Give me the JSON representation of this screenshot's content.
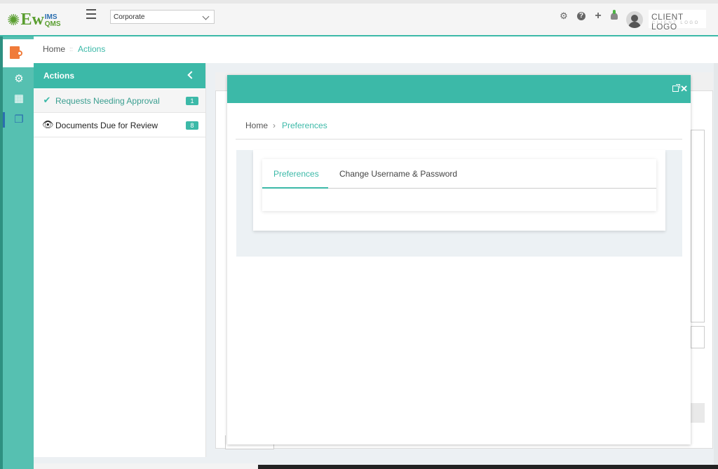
{
  "header": {
    "logo": {
      "main": "Ew",
      "sup": "IMS",
      "sub": "QMS"
    },
    "site_select": "Corporate",
    "icons": [
      "gear-icon",
      "help-icon",
      "plus-icon",
      "bell-icon"
    ],
    "client_logo": {
      "big": "CLIENT LOGO",
      "small": "CLIENT LOGO"
    }
  },
  "breadcrumb": {
    "home": "Home",
    "sep": "::",
    "current": "Actions"
  },
  "sidebar": {
    "title": "Actions",
    "items": [
      {
        "label": "Requests Needing Approval",
        "count": "1",
        "icon": "check-icon",
        "active": true
      },
      {
        "label": "Documents Due for Review",
        "count": "8",
        "icon": "eye-icon",
        "active": false
      }
    ]
  },
  "modal": {
    "breadcrumb": {
      "home": "Home",
      "sep": "›",
      "current": "Preferences"
    },
    "tabs": [
      "Preferences",
      "Change Username & Password"
    ],
    "active_tab": "Preferences",
    "close_glyph": "✕"
  },
  "colors": {
    "accent": "#3cb9a8",
    "rail": "#56c0b1",
    "brand_green": "#5a9e30",
    "brand_blue": "#2a6eb0"
  }
}
